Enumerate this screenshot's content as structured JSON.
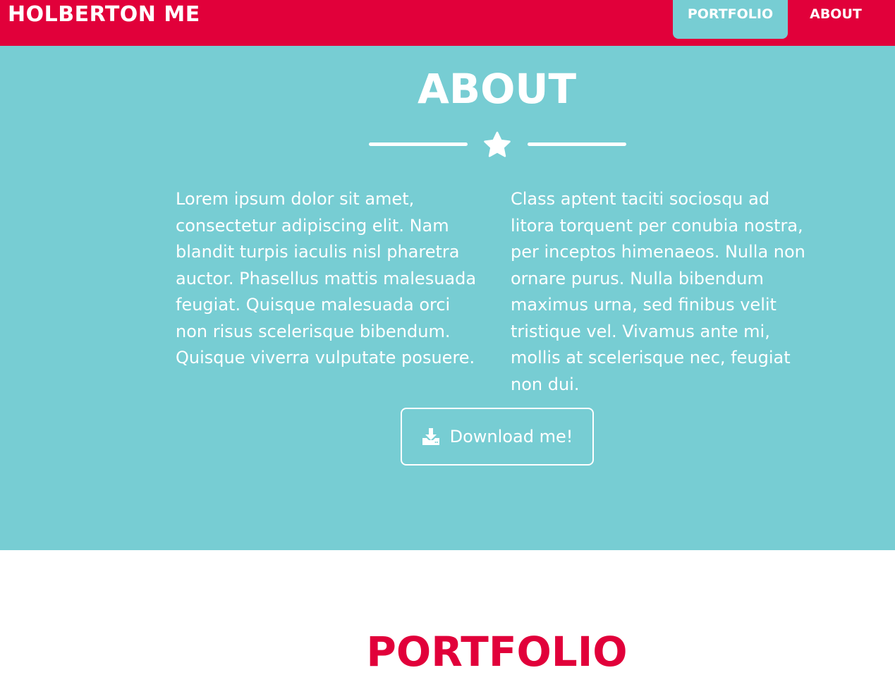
{
  "navbar": {
    "brand": "HOLBERTON ME",
    "items": [
      {
        "label": "PORTFOLIO",
        "active": true
      },
      {
        "label": "ABOUT",
        "active": false
      }
    ],
    "color": "#e1003a"
  },
  "about": {
    "title": "ABOUT",
    "background": "#77cdd3",
    "divider_icon": "star-icon",
    "paragraphs": [
      "Lorem ipsum dolor sit amet, consectetur adipiscing elit. Nam blandit turpis iaculis nisl pharetra auctor. Phasellus mattis malesuada feugiat. Quisque malesuada orci non risus scelerisque bibendum. Quisque viverra vulputate posuere.",
      "Class aptent taciti sociosqu ad litora torquent per conubia nostra, per inceptos himenaeos. Nulla non ornare purus. Nulla bibendum maximus urna, sed finibus velit tristique vel. Vivamus ante mi, mollis at scelerisque nec, feugiat non dui."
    ],
    "download_button": {
      "label": "Download me!",
      "icon": "download-icon"
    }
  },
  "portfolio": {
    "title": "PORTFOLIO",
    "color": "#e1003a"
  }
}
